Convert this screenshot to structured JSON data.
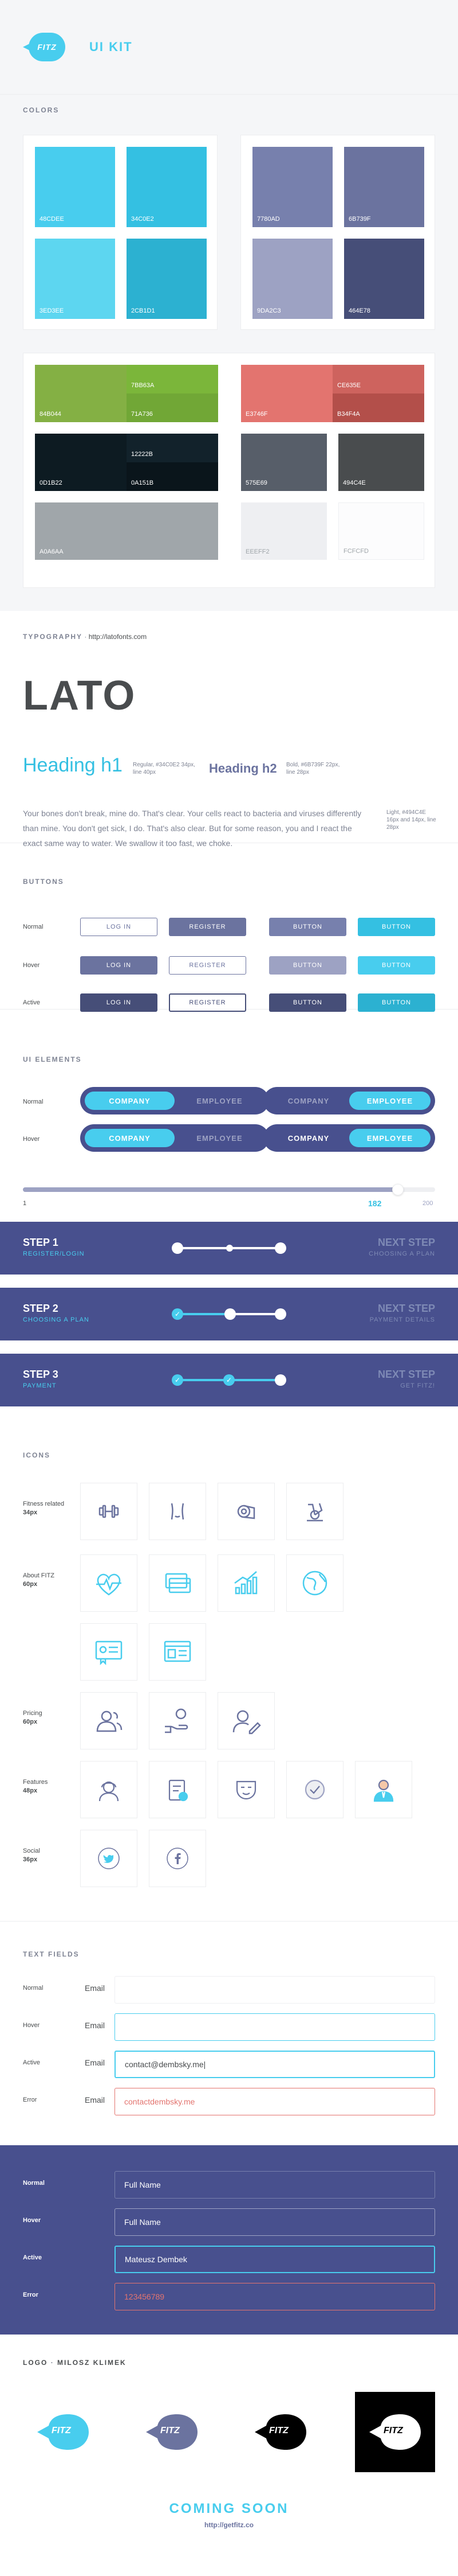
{
  "header": {
    "logo_text": "FITZ",
    "title": "UI KIT"
  },
  "colors": {
    "label": "COLORS",
    "blue": [
      "48CDEE",
      "34C0E2",
      "3ED3EE",
      "2CB1D1"
    ],
    "purple": [
      "7780AD",
      "6B739F",
      "9DA2C3",
      "464E78"
    ],
    "green": [
      "84B044",
      "7BB63A",
      "71A736"
    ],
    "red": [
      "E3746F",
      "CE635E",
      "B34F4A"
    ],
    "dark": [
      "0D1B22",
      "12222B",
      "0A151B"
    ],
    "grey": [
      "575E69",
      "494C4E"
    ],
    "light": [
      "A0A6AA",
      "EEEFF2",
      "FCFCFD"
    ]
  },
  "typography": {
    "label": "TYPOGRAPHY",
    "link": "http://latofonts.com",
    "font_name": "LATO",
    "h1": "Heading h1",
    "h1_meta": "Regular, #34C0E2 34px, line 40px",
    "h2": "Heading h2",
    "h2_meta": "Bold, #6B739F 22px, line 28px",
    "body_meta": "Light, #494C4E 16px and 14px, line 28px",
    "body": "Your bones don't break, mine do. That's clear. Your cells react to bacteria and viruses differently than mine. You don't get sick, I do. That's also clear. But for some reason, you and I react the exact same way to water. We swallow it too fast, we choke."
  },
  "buttons": {
    "label": "BUTTONS",
    "rows": [
      "Normal",
      "Hover",
      "Active"
    ],
    "login": "LOG IN",
    "register": "REGISTER",
    "button": "BUTTON"
  },
  "ui_elements": {
    "label": "UI ELEMENTS",
    "rows": [
      "Normal",
      "Hover"
    ],
    "company": "COMPANY",
    "employee": "EMPLOYEE",
    "slider_min": "1",
    "slider_value": "182",
    "slider_max": "200",
    "steps": [
      {
        "title": "STEP 1",
        "sub": "REGISTER/LOGIN",
        "next": "NEXT STEP",
        "next_sub": "CHOOSING A PLAN"
      },
      {
        "title": "STEP 2",
        "sub": "CHOOSING A PLAN",
        "next": "NEXT STEP",
        "next_sub": "PAYMENT DETAILS"
      },
      {
        "title": "STEP 3",
        "sub": "PAYMENT",
        "next": "NEXT STEP",
        "next_sub": "GET FITZ!"
      }
    ]
  },
  "icons": {
    "label": "ICONS",
    "groups": [
      {
        "name": "Fitness related",
        "size": "34px"
      },
      {
        "name": "About FITZ",
        "size": "60px"
      },
      {
        "name": "Pricing",
        "size": "60px"
      },
      {
        "name": "Features",
        "size": "48px"
      },
      {
        "name": "Social",
        "size": "36px"
      }
    ]
  },
  "text_fields": {
    "label": "TEXT FIELDS",
    "rows": [
      "Normal",
      "Hover",
      "Active",
      "Error"
    ],
    "email_label": "Email",
    "active_value": "contact@dembsky.me|",
    "error_value": "contactdembsky.me",
    "dark_rows": [
      "Normal",
      "Hover",
      "Active",
      "Error"
    ],
    "dark_placeholder": "Full Name",
    "dark_active_value": "Mateusz Dembek",
    "dark_error_value": "123456789"
  },
  "logo_section": {
    "label": "LOGO",
    "author": "MILOSZ KLIMEK",
    "logo_text": "FITZ"
  },
  "footer": {
    "coming_soon": "COMING SOON",
    "url": "http://getfitz.co"
  }
}
